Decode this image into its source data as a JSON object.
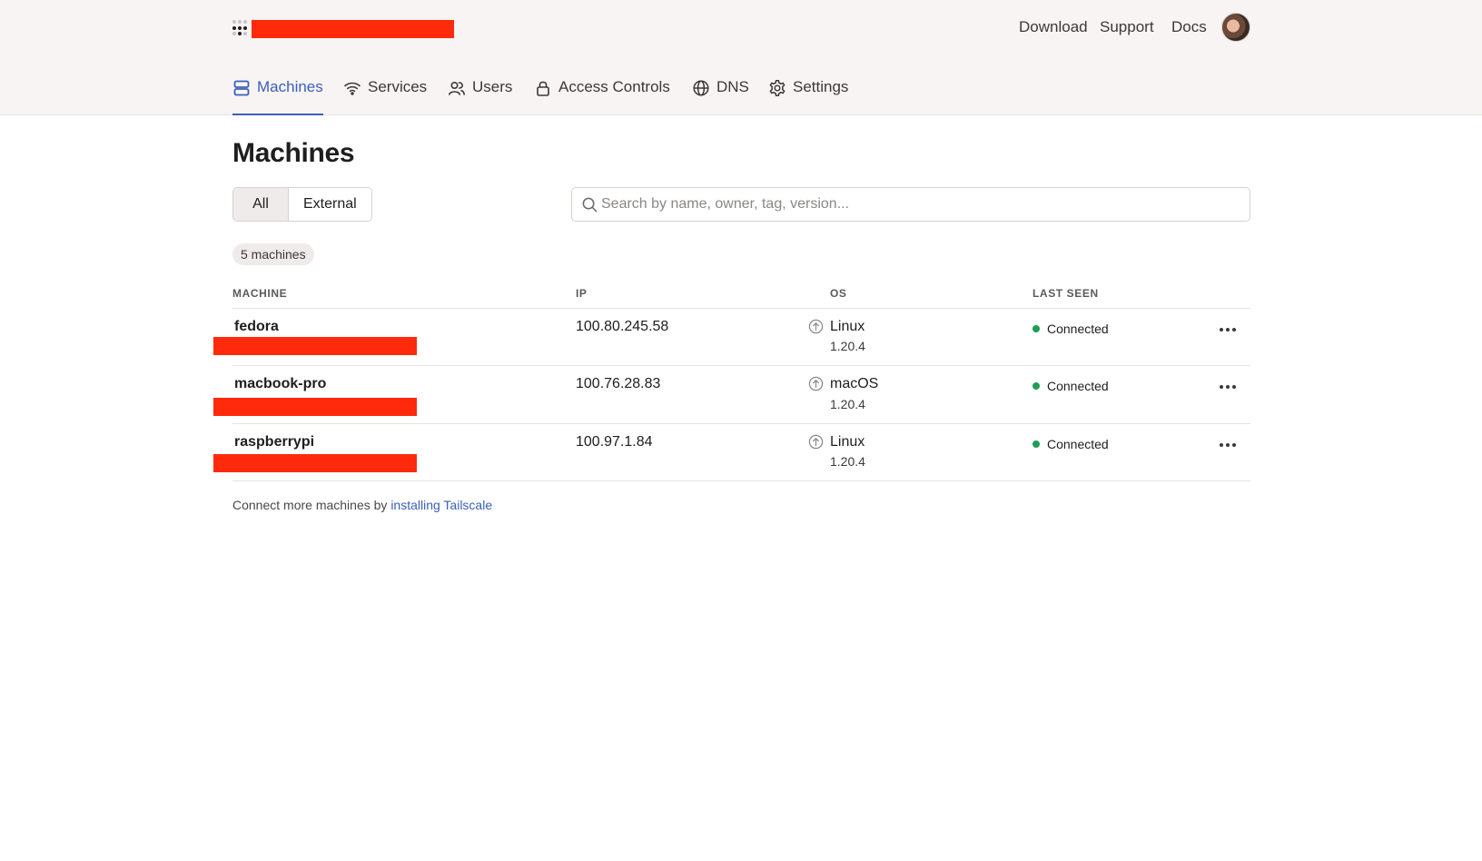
{
  "header": {
    "links": {
      "download": "Download",
      "support": "Support",
      "docs": "Docs"
    },
    "brand_color": "#3a5fb8",
    "redaction_color": "#ff2a0c"
  },
  "tabs": [
    {
      "label": "Machines",
      "icon": "machines-icon",
      "active": true
    },
    {
      "label": "Services",
      "icon": "wifi-icon"
    },
    {
      "label": "Users",
      "icon": "users-icon"
    },
    {
      "label": "Access Controls",
      "icon": "lock-icon"
    },
    {
      "label": "DNS",
      "icon": "globe-icon"
    },
    {
      "label": "Settings",
      "icon": "gear-icon"
    }
  ],
  "main": {
    "title": "Machines",
    "filters": {
      "all": "All",
      "external": "External",
      "selected": "All"
    },
    "search": {
      "placeholder": "Search by name, owner, tag, version...",
      "value": ""
    },
    "count_label": "5 machines",
    "columns": {
      "machine": "MACHINE",
      "ip": "IP",
      "os": "OS",
      "last_seen": "LAST SEEN"
    },
    "rows": [
      {
        "name": "fedora",
        "ip": "100.80.245.58",
        "os": "Linux",
        "version": "1.20.4",
        "status": "Connected"
      },
      {
        "name": "macbook-pro",
        "ip": "100.76.28.83",
        "os": "macOS",
        "version": "1.20.4",
        "status": "Connected"
      },
      {
        "name": "raspberrypi",
        "ip": "100.97.1.84",
        "os": "Linux",
        "version": "1.20.4",
        "status": "Connected"
      }
    ],
    "status_color": "#1f9d55",
    "footer": {
      "text": "Connect more machines by ",
      "link": "installing Tailscale"
    }
  }
}
